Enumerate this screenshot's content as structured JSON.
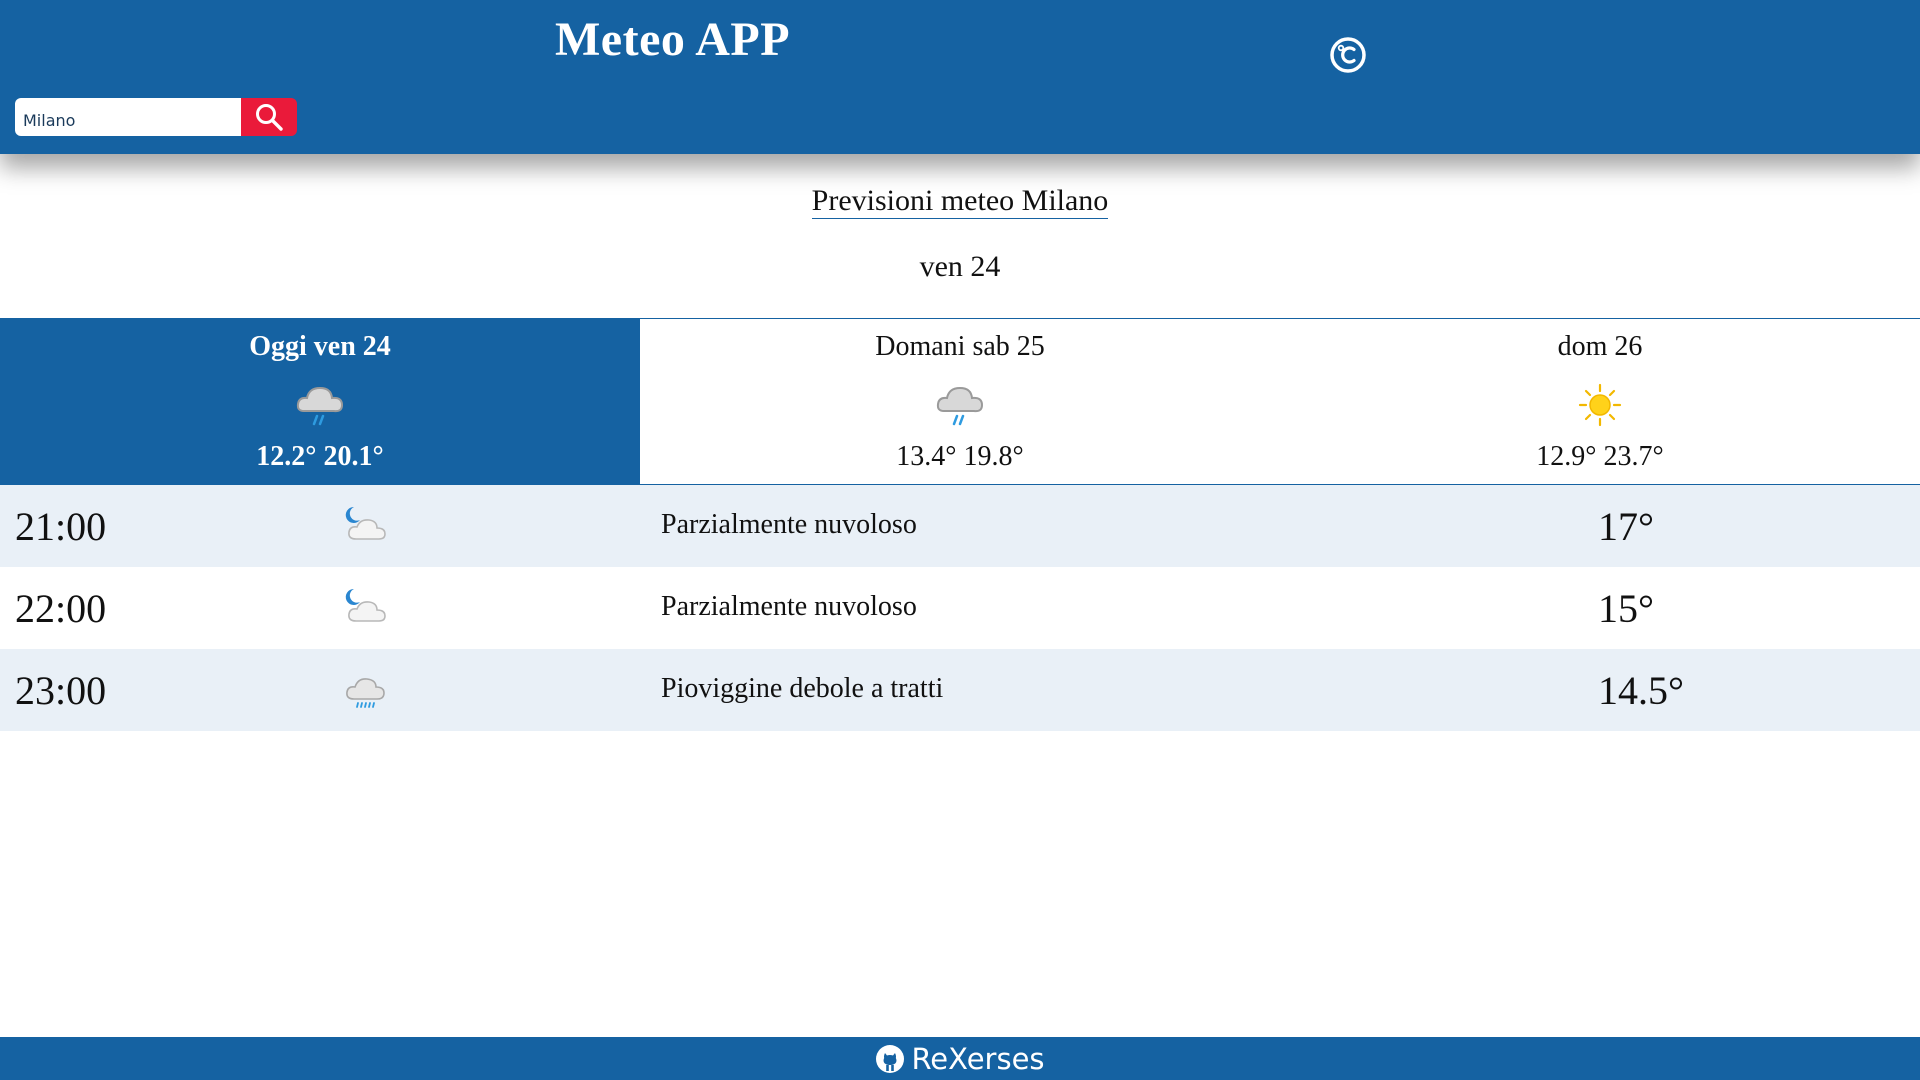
{
  "header": {
    "title": "Meteo APP",
    "unit_toggle_icon": "celsius-icon",
    "search": {
      "value": "Milano",
      "button_icon": "search-icon"
    }
  },
  "main": {
    "title": "Previsioni meteo Milano",
    "selected_date": "ven 24"
  },
  "days": [
    {
      "label": "Oggi ven 24",
      "icon": "rain-cloud-icon",
      "temps": "12.2° 20.1°",
      "active": true
    },
    {
      "label": "Domani sab 25",
      "icon": "rain-cloud-icon",
      "temps": "13.4° 19.8°",
      "active": false
    },
    {
      "label": "dom 26",
      "icon": "sun-icon",
      "temps": "12.9° 23.7°",
      "active": false
    }
  ],
  "hours": [
    {
      "time": "21:00",
      "icon": "moon-cloud-icon",
      "description": "Parzialmente nuvoloso",
      "temp": "17°"
    },
    {
      "time": "22:00",
      "icon": "moon-cloud-icon",
      "description": "Parzialmente nuvoloso",
      "temp": "15°"
    },
    {
      "time": "23:00",
      "icon": "drizzle-cloud-icon",
      "description": "Pioviggine debole a tratti",
      "temp": "14.5°"
    }
  ],
  "footer": {
    "text": "ReXerses",
    "icon": "github-icon"
  },
  "colors": {
    "primary": "#1562a2",
    "accent": "#ea1a3a",
    "row_alt": "#e9f0f7"
  }
}
